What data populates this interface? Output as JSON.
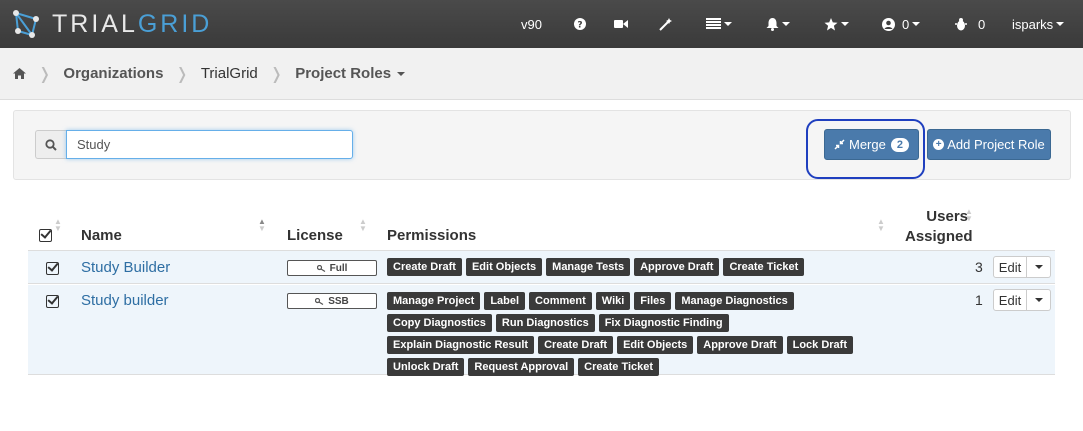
{
  "brand": {
    "part1": "TRIAL",
    "part2": "GRID"
  },
  "nav": {
    "version": "v90",
    "counter_1": "0",
    "counter_2": "0",
    "user": "isparks"
  },
  "breadcrumb": {
    "organizations": "Organizations",
    "org": "TrialGrid",
    "current": "Project Roles"
  },
  "search": {
    "value": "Study"
  },
  "actions": {
    "merge_label": "Merge",
    "merge_count": "2",
    "add_label": "Add Project Role"
  },
  "table": {
    "headers": {
      "name": "Name",
      "license": "License",
      "permissions": "Permissions",
      "users_1": "Users",
      "users_2": "Assigned"
    },
    "rows": [
      {
        "name": "Study Builder",
        "license": "Full",
        "users": "3",
        "edit": "Edit",
        "permissions": [
          "Create Draft",
          "Edit Objects",
          "Manage Tests",
          "Approve Draft",
          "Create Ticket"
        ]
      },
      {
        "name": "Study builder",
        "license": "SSB",
        "users": "1",
        "edit": "Edit",
        "permissions": [
          "Manage Project",
          "Label",
          "Comment",
          "Wiki",
          "Files",
          "Manage Diagnostics",
          "Copy Diagnostics",
          "Run Diagnostics",
          "Fix Diagnostic Finding",
          "Explain Diagnostic Result",
          "Create Draft",
          "Edit Objects",
          "Approve Draft",
          "Lock Draft",
          "Unlock Draft",
          "Request Approval",
          "Create Ticket"
        ]
      }
    ]
  },
  "colors": {
    "accent": "#4a7aab",
    "link": "#2e6ea3",
    "brand_blue": "#4a9fd6"
  },
  "icons": [
    "home-icon",
    "help-icon",
    "video-icon",
    "magic-wand-icon",
    "list-icon",
    "bell-icon",
    "star-icon",
    "user-circle-icon",
    "bug-icon",
    "search-icon",
    "compress-icon",
    "plus-circle-icon",
    "key-icon"
  ]
}
